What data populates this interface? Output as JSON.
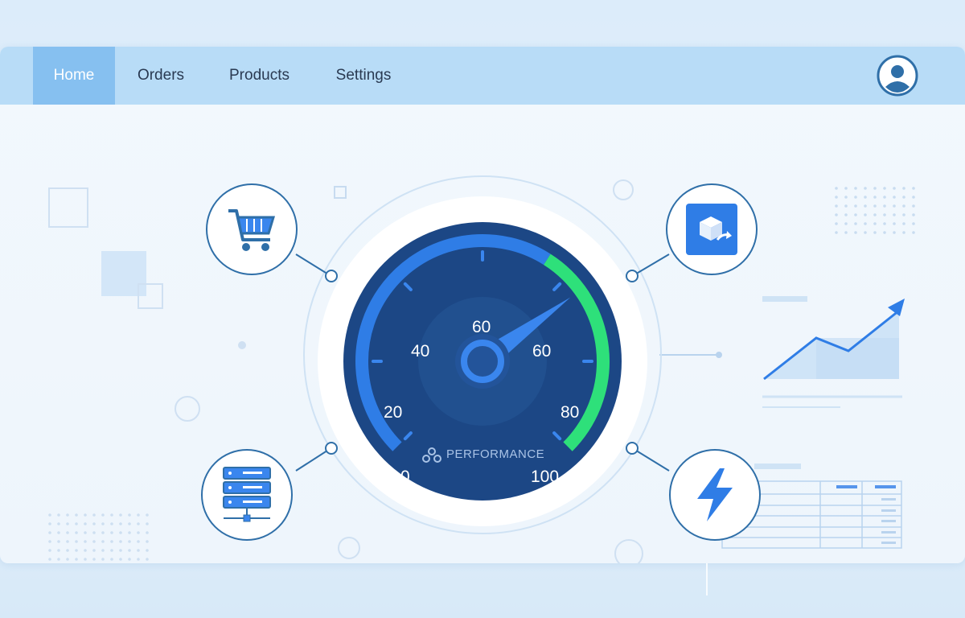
{
  "nav": {
    "items": [
      {
        "label": "Home",
        "active": true
      },
      {
        "label": "Orders",
        "active": false
      },
      {
        "label": "Products",
        "active": false
      },
      {
        "label": "Settings",
        "active": false
      }
    ]
  },
  "gauge": {
    "title": "PERFORMANCE",
    "ticks": [
      "0",
      "20",
      "40",
      "60",
      "60",
      "80",
      "100"
    ],
    "value_percent": 70,
    "colors": {
      "track": "#2f7de6",
      "highlight": "#2ee07a",
      "face": "#1c4785",
      "needle": "#3a86ee"
    }
  },
  "nodes": [
    {
      "name": "cart",
      "icon": "shopping-cart-icon"
    },
    {
      "name": "shipping",
      "icon": "package-shipping-icon"
    },
    {
      "name": "server",
      "icon": "server-stack-icon"
    },
    {
      "name": "speed",
      "icon": "lightning-bolt-icon"
    }
  ],
  "colors": {
    "accent": "#2f7de6",
    "nav_bg": "#b8dcf7",
    "nav_active": "#86c0f0"
  }
}
